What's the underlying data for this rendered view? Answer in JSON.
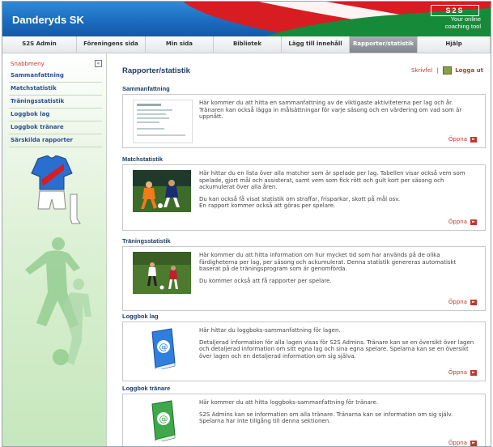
{
  "header": {
    "club_name": "Danderyds SK",
    "logo_text": "S2S",
    "tagline_line1": "Your online",
    "tagline_line2": "coaching tool"
  },
  "nav": {
    "tabs": [
      {
        "label": "S2S Admin",
        "active": false
      },
      {
        "label": "Föreningens sida",
        "active": false
      },
      {
        "label": "Min sida",
        "active": false
      },
      {
        "label": "Bibliotek",
        "active": false
      },
      {
        "label": "Lägg till innehåll",
        "active": false
      },
      {
        "label": "Rapporter/statistik",
        "active": true
      },
      {
        "label": "Hjälp",
        "active": false
      }
    ]
  },
  "sidebar": {
    "title": "Snabbmeny",
    "collapse_label": "«",
    "items": [
      {
        "label": "Sammanfattning"
      },
      {
        "label": "Matchstatistik"
      },
      {
        "label": "Träningsstatistik"
      },
      {
        "label": "Loggbok lag"
      },
      {
        "label": "Loggbok tränare"
      },
      {
        "label": "Särskilda rapporter"
      }
    ]
  },
  "main": {
    "title": "Rapporter/statistik",
    "print_label": "Skrivfel",
    "separator": "|",
    "logout_label": "Logga ut",
    "open_label": "Öppna",
    "sections": [
      {
        "title": "Sammanfattning",
        "paragraphs": [
          "Här kommer du att hitta en sammanfattning av de viktigaste aktiviteterna per lag och år. Tränaren kan också lägga in målsättningar för varje säsong och en värdering om vad som är uppnått."
        ]
      },
      {
        "title": "Matchstatistik",
        "paragraphs": [
          "Här hittar du en lista över alla matcher som är spelade per lag. Tabellen visar också vem som spelade, gjort mål och assisterat, samt vem som fick rött och gult kort per säsong och ackumulerat över alla åren.",
          "Du kan också få visat statistik om straffar, frisparkar, skott på mål osv.\nEn rapport kommer också att göras per spelare."
        ]
      },
      {
        "title": "Träningsstatistik",
        "paragraphs": [
          "Här kommer du att hitta information om hur mycket tid som har används på de olika färdigheterna per lag, per säsong och ackumulerat. Denna statistik genereras automatiskt baserat på de träningsprogram som är genomförda.",
          "Du kommer också att få rapporter per spelare."
        ]
      },
      {
        "title": "Loggbok lag",
        "paragraphs": [
          "Här hittar du loggboks-sammanfattning för lagen.",
          "Detaljerad information för alla lagen visas för S2S Admins. Tränare kan se en översikt över lagen och detaljerad information om sitt egna lag och sina egna spelare. Spelarna kan se en översikt över lagen och en detaljerad information om sig själva."
        ]
      },
      {
        "title": "Loggbok tränare",
        "paragraphs": [
          "Här kommer du att hitta loggboks-sammanfattning för tränare.",
          "S2S Admins kan se information om alla tränare. Tränarna kan se information om sig själv. Spelarna har inte tillgång till denna sektionen."
        ]
      }
    ]
  },
  "colors": {
    "header_blue": "#1c6cc0",
    "header_red": "#d71d22",
    "header_green": "#178a3a",
    "link_red": "#c0392b",
    "title_navy": "#1d3b66",
    "active_tab": "#80868b"
  }
}
